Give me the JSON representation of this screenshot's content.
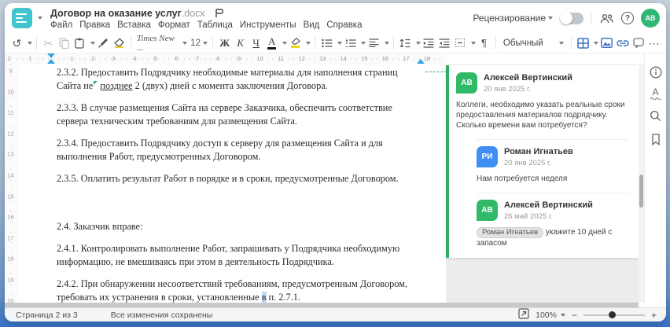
{
  "header": {
    "title": "Договор на оказание услуг",
    "title_ext": ".docx",
    "menus": [
      "Файл",
      "Правка",
      "Вставка",
      "Формат",
      "Таблица",
      "Инструменты",
      "Вид",
      "Справка"
    ],
    "review_label": "Рецензирование",
    "avatar_initials": "АВ"
  },
  "toolbar": {
    "font_name": "Times New ...",
    "font_size": "12",
    "bold_label": "Ж",
    "italic_label": "К",
    "underline_label": "Ч",
    "font_color_letter": "А",
    "style_name": "Обычный",
    "icons": {
      "undo": "↺",
      "cut": "✂",
      "pilcrow": "¶",
      "more": "⋯",
      "help": "?",
      "minus": "−",
      "plus": "+"
    }
  },
  "ruler": {
    "h_numbers": [
      "2",
      "1",
      "1",
      "2",
      "3",
      "4",
      "5",
      "6",
      "7",
      "8",
      "9",
      "10",
      "11",
      "12",
      "13",
      "14",
      "15",
      "16",
      "17",
      "18"
    ],
    "v_numbers": [
      "9",
      "10",
      "11",
      "12",
      "13",
      "14",
      "15",
      "16",
      "17",
      "18",
      "19",
      "20"
    ]
  },
  "document": {
    "p232_l1": "2.3.2. Предоставить Подрядчику необходимые материалы для наполнения страниц Сайта не",
    "p232_underlined": "позднее",
    "p232_rest": " 2 (двух) дней с момента заключения Договора.",
    "p233": "2.3.3. В случае размещения Сайта на сервере Заказчика, обеспечить соответствие сервера техническим требованиям для размещения Сайта.",
    "p234": "2.3.4. Предоставить Подрядчику доступ к серверу для размещения Сайта и для выполнения Работ, предусмотренных Договором.",
    "p235": "2.3.5. Оплатить результат Работ в порядке и в сроки, предусмотренные Договором.",
    "p24": "2.4. Заказчик вправе:",
    "p241": "2.4.1. Контролировать выполнение Работ, запрашивать у Подрядчика необходимую информацию, не вмешиваясь при этом в деятельность Подрядчика.",
    "p242_l1": "2.4.2. При обнаружении несоответствий требованиям, предусмотренным Договором, требовать",
    "p242_pre": "их устранения в сроки, установленные ",
    "p242_hl": "в",
    "p242_post": " п. 2.7.1."
  },
  "comments": {
    "thread": [
      {
        "initials": "АВ",
        "name": "Алексей Вертинский",
        "date": "20 янв 2025 г.",
        "text": "Коллеги, необходимо указать реальные сроки предоставления материалов подрядчику. Сколько времени вам потребуется?",
        "color": "#30ba68"
      },
      {
        "initials": "РИ",
        "name": "Роман Игнатьев",
        "date": "20 янв 2025 г.",
        "text": "Нам потребуется неделя",
        "color": "#3f8ef3"
      },
      {
        "initials": "АВ",
        "name": "Алексей Вертинский",
        "date": "26 май 2025 г.",
        "mention": "Роман Игнатьев",
        "text": " укажите 10 дней с запасом",
        "color": "#30ba68"
      }
    ]
  },
  "statusbar": {
    "page_label": "Страница 2 из 3",
    "saved_label": "Все изменения сохранены",
    "zoom_value": "100%"
  },
  "colors": {
    "logo_teal": "#3fc4d0",
    "accent_green": "#2fae63",
    "avatar_green": "#30ba68",
    "avatar_blue": "#3f8ef3",
    "toolbar_icon_blue": "#4472c4",
    "indent_marker_blue": "#35a3dd"
  }
}
